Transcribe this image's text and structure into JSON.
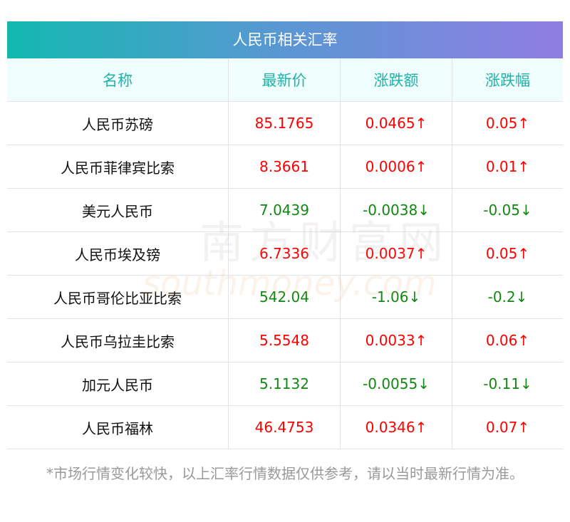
{
  "title": "人民币相关汇率",
  "headers": [
    "名称",
    "最新价",
    "涨跌额",
    "涨跌幅"
  ],
  "rows": [
    {
      "name": "人民币苏磅",
      "price": "85.1765",
      "change": "0.0465↑",
      "pct": "0.05↑",
      "dir": "up"
    },
    {
      "name": "人民币菲律宾比索",
      "price": "8.3661",
      "change": "0.0006↑",
      "pct": "0.01↑",
      "dir": "up"
    },
    {
      "name": "美元人民币",
      "price": "7.0439",
      "change": "-0.0038↓",
      "pct": "-0.05↓",
      "dir": "down"
    },
    {
      "name": "人民币埃及镑",
      "price": "6.7336",
      "change": "0.0037↑",
      "pct": "0.05↑",
      "dir": "up"
    },
    {
      "name": "人民币哥伦比亚比索",
      "price": "542.04",
      "change": "-1.06↓",
      "pct": "-0.2↓",
      "dir": "down"
    },
    {
      "name": "人民币乌拉圭比索",
      "price": "5.5548",
      "change": "0.0033↑",
      "pct": "0.06↑",
      "dir": "up"
    },
    {
      "name": "加元人民币",
      "price": "5.1132",
      "change": "-0.0055↓",
      "pct": "-0.11↓",
      "dir": "down"
    },
    {
      "name": "人民币福林",
      "price": "46.4753",
      "change": "0.0346↑",
      "pct": "0.07↑",
      "dir": "up"
    }
  ],
  "note": "*市场行情变化较快，以上汇率行情数据仅供参考，请以当时最新行情为准。",
  "watermark": {
    "cn": "南方财富网",
    "en": "southmoney.com"
  },
  "colors": {
    "up": "#ff0000",
    "down": "#118811",
    "header_text": "#21b2a8"
  }
}
